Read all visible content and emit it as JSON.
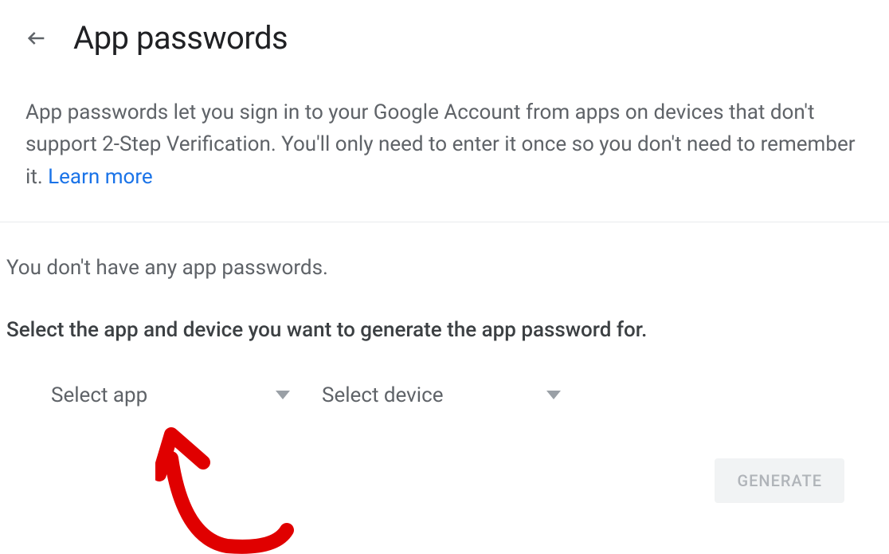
{
  "header": {
    "title": "App passwords"
  },
  "description": {
    "text": "App passwords let you sign in to your Google Account from apps on devices that don't support 2-Step Verification. You'll only need to enter it once so you don't need to remember it. ",
    "learn_more": "Learn more"
  },
  "status": {
    "no_passwords": "You don't have any app passwords."
  },
  "instruction": {
    "text": "Select the app and device you want to generate the app password for."
  },
  "dropdowns": {
    "app": {
      "label": "Select app"
    },
    "device": {
      "label": "Select device"
    }
  },
  "actions": {
    "generate": "GENERATE"
  }
}
